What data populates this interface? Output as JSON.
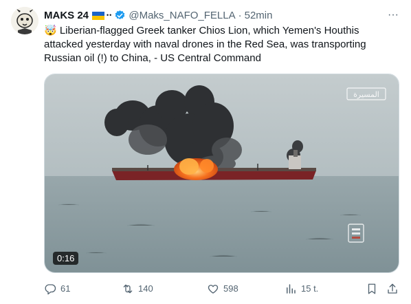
{
  "author": {
    "name": "MAKS 24",
    "flag_icon": "ukraine-flag-icon",
    "dots": "••",
    "verified_icon": "verified-badge-icon",
    "handle": "@Maks_NAFO_FELLA",
    "separator": "·",
    "time": "52min"
  },
  "more_label": "···",
  "tweet_text": "🤯 Liberian-flagged Greek tanker Chios Lion, which Yemen's Houthis attacked yesterday with naval drones in the Red Sea, was transporting Russian oil (!) to China, - US Central Command",
  "media": {
    "type": "video",
    "duration": "0:16",
    "watermark": "المسيرة",
    "colors": {
      "sky": "#b9c3c6",
      "sea": "#8e9ea3",
      "fire": "#f05a1e",
      "smoke": "#2f3134"
    }
  },
  "actions": {
    "replies": "61",
    "reposts": "140",
    "likes": "598",
    "views": "15 t."
  },
  "colors": {
    "text": "#0f1419",
    "muted": "#536471",
    "verified": "#1d9bf0"
  }
}
